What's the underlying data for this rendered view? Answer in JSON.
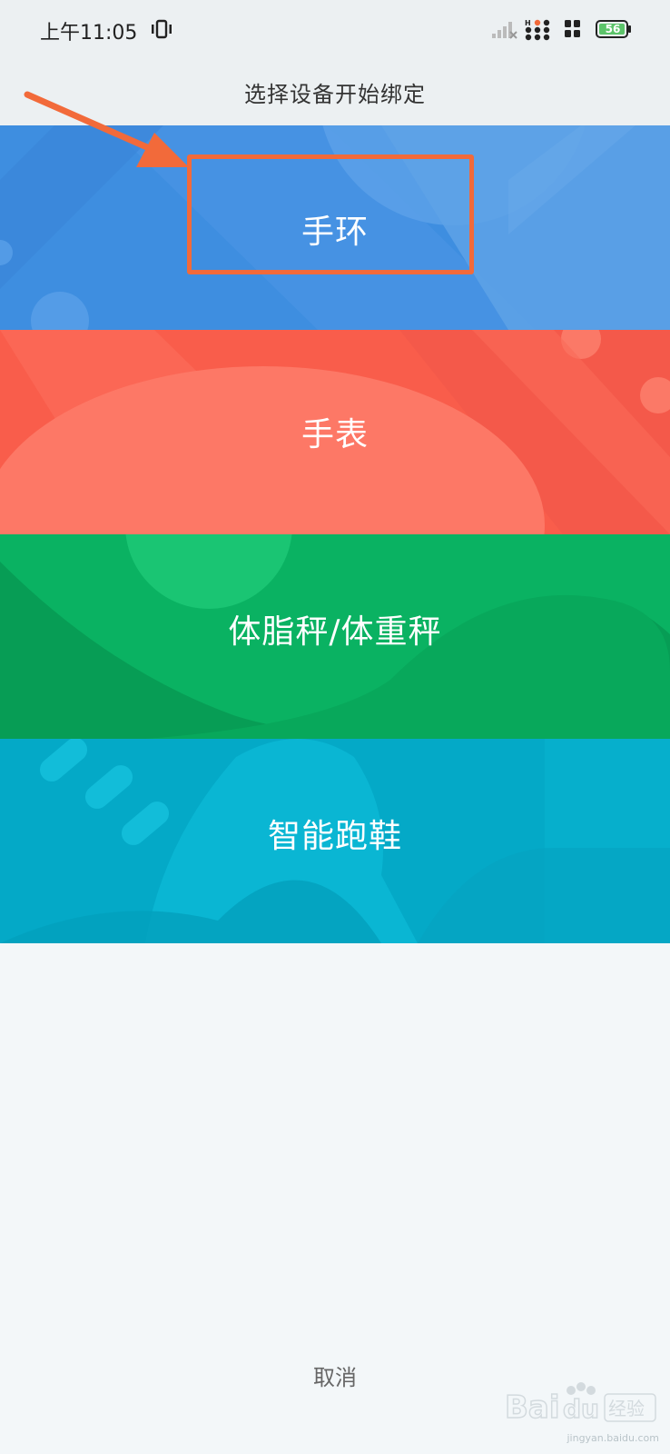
{
  "status_bar": {
    "time": "上午11:05",
    "battery_level": "56",
    "icons": [
      "vibrate-icon",
      "signal-icon",
      "notification-dots-icon",
      "grid-icon",
      "battery-icon"
    ]
  },
  "header": {
    "title": "选择设备开始绑定"
  },
  "device_cards": [
    {
      "label": "手环",
      "color": "#3e8ee0"
    },
    {
      "label": "手表",
      "color": "#f95d4b"
    },
    {
      "label": "体脂秤/体重秤",
      "color": "#0ab262"
    },
    {
      "label": "智能跑鞋",
      "color": "#04a9c7"
    }
  ],
  "annotation": {
    "highlight_color": "#f26a3a"
  },
  "footer": {
    "cancel_label": "取消"
  },
  "watermark": {
    "brand": "Baidu 经验",
    "url": "jingyan.baidu.com"
  }
}
